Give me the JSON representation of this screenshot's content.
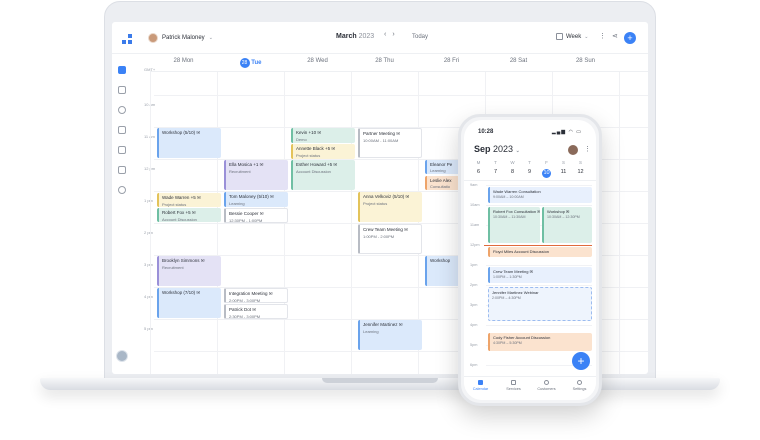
{
  "desktop": {
    "user_name": "Patrick Maloney",
    "month": "March",
    "year": "2023",
    "today_label": "Today",
    "view_label": "Week",
    "days": [
      {
        "num": "28",
        "name": "Mon"
      },
      {
        "num": "28",
        "name": "Tue"
      },
      {
        "num": "28",
        "name": "Wed"
      },
      {
        "num": "28",
        "name": "Thu"
      },
      {
        "num": "28",
        "name": "Fri"
      },
      {
        "num": "28",
        "name": "Sat"
      },
      {
        "num": "28",
        "name": "Sun"
      }
    ],
    "time_labels": [
      "GMT+",
      "10 am",
      "11 am",
      "12 pm",
      "1 pm",
      "2 pm",
      "3 pm",
      "4 pm",
      "5 pm"
    ],
    "events": [
      {
        "title": "Workshop (5/10) ✉",
        "sub": "",
        "color": "blue"
      },
      {
        "title": "Ella Mosica +1 ✉",
        "sub": "Recruitment",
        "color": "purple"
      },
      {
        "title": "Kevin +10 ✉",
        "sub": "Demo",
        "color": "green"
      },
      {
        "title": "Annette Black +5 ✉",
        "sub": "Project status",
        "color": "yellow"
      },
      {
        "title": "Partner Meeting ✉",
        "sub": "10:00AM - 11:00AM",
        "color": "white"
      },
      {
        "title": "Esther Howard +5 ✉",
        "sub": "Account Discussion",
        "color": "green"
      },
      {
        "title": "Eleanor Pe",
        "sub": "Learning",
        "color": "blue"
      },
      {
        "title": "Leslie Alex",
        "sub": "Consultatio",
        "color": "orange"
      },
      {
        "title": "Wade Warren +5 ✉",
        "sub": "Project status",
        "color": "yellow"
      },
      {
        "title": "Tom Maloney (5/10) ✉",
        "sub": "Learning",
        "color": "blue"
      },
      {
        "title": "Anna Velkoviz (5/10) ✉",
        "sub": "Project status",
        "color": "yellow"
      },
      {
        "title": "Robert Fox +5 ✉",
        "sub": "Account Discussion",
        "color": "green"
      },
      {
        "title": "Bessie Cooper ✉",
        "sub": "12:30PM - 1:00PM",
        "color": "white"
      },
      {
        "title": "Crew Team Meeting ✉",
        "sub": "1:00PM - 2:00PM",
        "color": "white"
      },
      {
        "title": "Brooklyn Simmons ✉",
        "sub": "Recruitment",
        "color": "purple"
      },
      {
        "title": "Workshop",
        "sub": "",
        "color": "blue"
      },
      {
        "title": "Workshop (7/10) ✉",
        "sub": "",
        "color": "blue"
      },
      {
        "title": "Integration Meeting ✉",
        "sub": "2:00PM - 3:00PM",
        "color": "white"
      },
      {
        "title": "Patrick Dot ✉",
        "sub": "2:30PM - 3:00PM",
        "color": "white"
      },
      {
        "title": "Jennifer Martinez ✉",
        "sub": "Learning",
        "color": "blue"
      }
    ]
  },
  "phone": {
    "clock": "10:28",
    "status": "▂▄▆ ◠ ▭",
    "month": "Sep",
    "year": "2023",
    "weekdays": [
      "M",
      "T",
      "W",
      "T",
      "F",
      "S",
      "S"
    ],
    "daynums": [
      "6",
      "7",
      "8",
      "9",
      "10",
      "11",
      "12"
    ],
    "time_labels": [
      "9am",
      "10am",
      "11am",
      "12pm",
      "1pm",
      "2pm",
      "3pm",
      "4pm",
      "5pm",
      "6pm"
    ],
    "events": [
      {
        "title": "Wade Warren Consultation",
        "sub": "9:00AM – 10:00AM",
        "color": "blue"
      },
      {
        "title": "Robert Fox Consultation ✉",
        "sub": "10:30AM – 11:30AM",
        "color": "green"
      },
      {
        "title": "Workshop ✉",
        "sub": "10:30AM – 12:30PM",
        "color": "green"
      },
      {
        "title": "Floyd Miles Account Discussion",
        "sub": "",
        "color": "orange"
      },
      {
        "title": "Crew Team Meeting ✉",
        "sub": "1:00PM – 1:30PM",
        "color": "blue"
      },
      {
        "title": "Jennifer Martinez Webinar",
        "sub": "2:00PM – 4:30PM",
        "color": "dash"
      },
      {
        "title": "Cody Fisher Account Discussion",
        "sub": "4:30PM – 5:30PM",
        "color": "orange"
      }
    ],
    "tabs": [
      "Calendar",
      "Services",
      "Customers",
      "Settings"
    ]
  }
}
